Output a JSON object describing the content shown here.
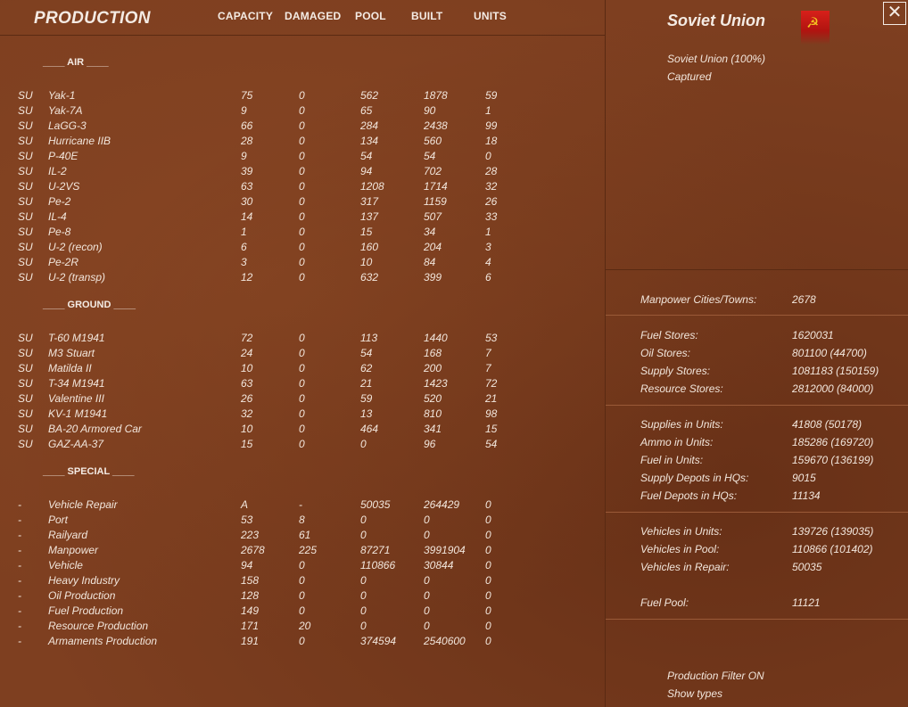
{
  "header": {
    "title": "PRODUCTION",
    "columns": [
      "CAPACITY",
      "DAMAGED",
      "POOL",
      "BUILT",
      "UNITS"
    ]
  },
  "sections": [
    {
      "label": "____  AIR  ____",
      "rows": [
        [
          "SU",
          "Yak-1",
          "75",
          "0",
          "562",
          "1878",
          "59"
        ],
        [
          "SU",
          "Yak-7A",
          "9",
          "0",
          "65",
          "90",
          "1"
        ],
        [
          "SU",
          "LaGG-3",
          "66",
          "0",
          "284",
          "2438",
          "99"
        ],
        [
          "SU",
          "Hurricane IIB",
          "28",
          "0",
          "134",
          "560",
          "18"
        ],
        [
          "SU",
          "P-40E",
          "9",
          "0",
          "54",
          "54",
          "0"
        ],
        [
          "SU",
          "IL-2",
          "39",
          "0",
          "94",
          "702",
          "28"
        ],
        [
          "SU",
          "U-2VS",
          "63",
          "0",
          "1208",
          "1714",
          "32"
        ],
        [
          "SU",
          "Pe-2",
          "30",
          "0",
          "317",
          "1159",
          "26"
        ],
        [
          "SU",
          "IL-4",
          "14",
          "0",
          "137",
          "507",
          "33"
        ],
        [
          "SU",
          "Pe-8",
          "1",
          "0",
          "15",
          "34",
          "1"
        ],
        [
          "SU",
          "U-2 (recon)",
          "6",
          "0",
          "160",
          "204",
          "3"
        ],
        [
          "SU",
          "Pe-2R",
          "3",
          "0",
          "10",
          "84",
          "4"
        ],
        [
          "SU",
          "U-2 (transp)",
          "12",
          "0",
          "632",
          "399",
          "6"
        ]
      ]
    },
    {
      "label": "____ GROUND ____",
      "rows": [
        [
          "SU",
          "T-60 M1941",
          "72",
          "0",
          "113",
          "1440",
          "53"
        ],
        [
          "SU",
          "M3 Stuart",
          "24",
          "0",
          "54",
          "168",
          "7"
        ],
        [
          "SU",
          "Matilda II",
          "10",
          "0",
          "62",
          "200",
          "7"
        ],
        [
          "SU",
          "T-34 M1941",
          "63",
          "0",
          "21",
          "1423",
          "72"
        ],
        [
          "SU",
          "Valentine III",
          "26",
          "0",
          "59",
          "520",
          "21"
        ],
        [
          "SU",
          "KV-1 M1941",
          "32",
          "0",
          "13",
          "810",
          "98"
        ],
        [
          "SU",
          "BA-20 Armored Car",
          "10",
          "0",
          "464",
          "341",
          "15"
        ],
        [
          "SU",
          "GAZ-AA-37",
          "15",
          "0",
          "0",
          "96",
          "54"
        ]
      ]
    },
    {
      "label": "____ SPECIAL ____",
      "rows": [
        [
          "-",
          "Vehicle Repair",
          "A",
          "-",
          "50035",
          "264429",
          "0"
        ],
        [
          "-",
          "Port",
          "53",
          "8",
          "0",
          "0",
          "0"
        ],
        [
          "-",
          "Railyard",
          "223",
          "61",
          "0",
          "0",
          "0"
        ],
        [
          "-",
          "Manpower",
          "2678",
          "225",
          "87271",
          "3991904",
          "0"
        ],
        [
          "-",
          "Vehicle",
          "94",
          "0",
          "110866",
          "30844",
          "0"
        ],
        [
          "-",
          "Heavy Industry",
          "158",
          "0",
          "0",
          "0",
          "0"
        ],
        [
          "-",
          "Oil Production",
          "128",
          "0",
          "0",
          "0",
          "0"
        ],
        [
          "-",
          "Fuel Production",
          "149",
          "0",
          "0",
          "0",
          "0"
        ],
        [
          "-",
          "Resource Production",
          "171",
          "20",
          "0",
          "0",
          "0"
        ],
        [
          "-",
          "Armaments Production",
          "191",
          "0",
          "374594",
          "2540600",
          "0"
        ]
      ]
    }
  ],
  "side": {
    "country": "Soviet Union",
    "flag_icon": "hammer-sickle-icon",
    "flag_symbol": "☭",
    "control": "Soviet Union  (100%)",
    "captured": "Captured",
    "close_symbol": "✕",
    "groups": [
      [
        [
          "Manpower Cities/Towns:",
          "2678"
        ]
      ],
      [
        [
          "Fuel Stores:",
          "1620031"
        ],
        [
          "Oil Stores:",
          "801100 (44700)"
        ],
        [
          "Supply Stores:",
          "1081183 (150159)"
        ],
        [
          "Resource Stores:",
          "2812000 (84000)"
        ]
      ],
      [
        [
          "Supplies in Units:",
          "41808 (50178)"
        ],
        [
          "Ammo in Units:",
          "185286 (169720)"
        ],
        [
          "Fuel in Units:",
          "159670 (136199)"
        ],
        [
          "Supply Depots in HQs:",
          "9015"
        ],
        [
          "Fuel Depots in HQs:",
          "11134"
        ]
      ],
      [
        [
          "Vehicles in Units:",
          "139726 (139035)"
        ],
        [
          "Vehicles in Pool:",
          "110866 (101402)"
        ],
        [
          "Vehicles in Repair:",
          "50035"
        ],
        [
          "Fuel Pool:",
          "11121"
        ]
      ]
    ],
    "production_filter": "Production Filter ON",
    "show_types": "Show types"
  },
  "colors": {
    "background": "#7e3f20",
    "text": "#f2e6dc",
    "flag_red": "#d8201a",
    "flag_gold": "#f4c820"
  }
}
